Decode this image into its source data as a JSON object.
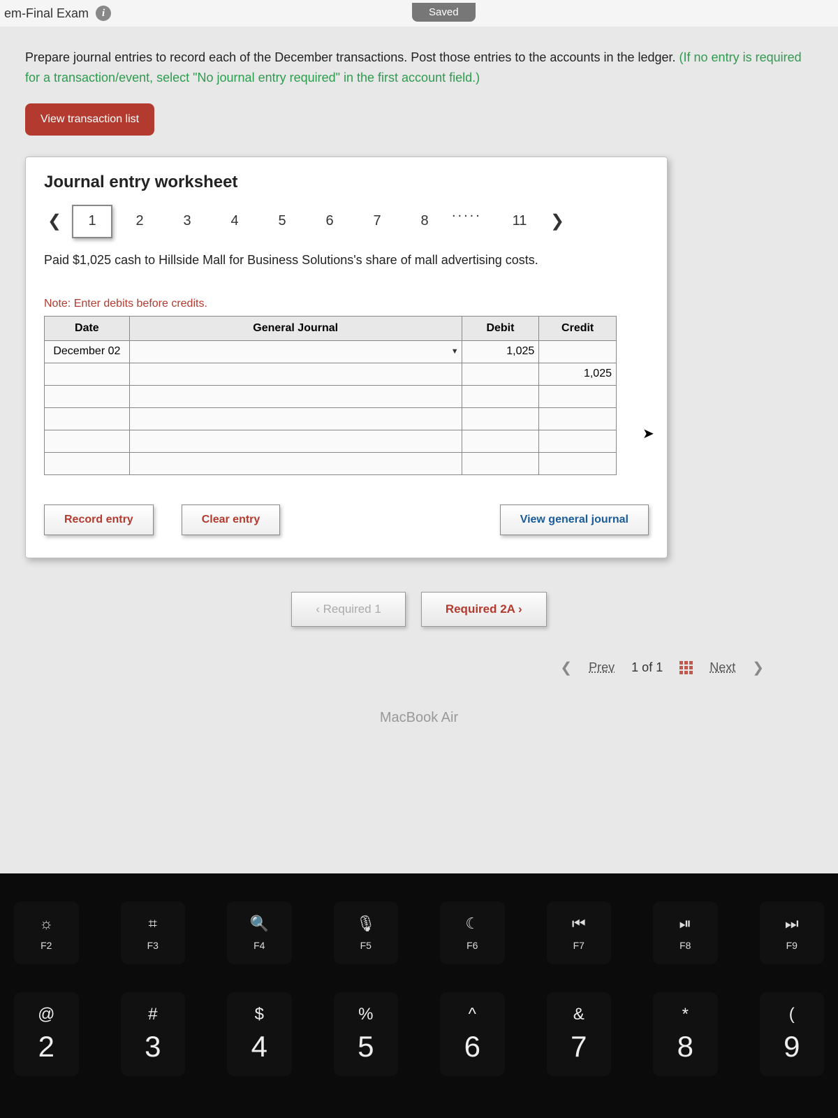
{
  "header": {
    "title": "em-Final Exam",
    "saved_label": "Saved"
  },
  "instructions": {
    "black": "Prepare journal entries to record each of the December transactions. Post those entries to the accounts in the ledger. ",
    "green": "(If no entry is required for a transaction/event, select \"No journal entry required\" in the first account field.)"
  },
  "buttons": {
    "view_tx": "View transaction list",
    "record": "Record entry",
    "clear": "Clear entry",
    "view_gj": "View general journal",
    "req1": "‹   Required 1",
    "req2": "Required 2A   ›"
  },
  "worksheet": {
    "title": "Journal entry worksheet",
    "tabs": [
      "1",
      "2",
      "3",
      "4",
      "5",
      "6",
      "7",
      "8",
      ".....",
      "11"
    ],
    "selected_tab": "1",
    "transaction_text": "Paid $1,025 cash to Hillside Mall for Business Solutions's share of mall advertising costs.",
    "note": "Note: Enter debits before credits.",
    "columns": {
      "date": "Date",
      "gj": "General Journal",
      "debit": "Debit",
      "credit": "Credit"
    },
    "rows": [
      {
        "date": "December 02",
        "gj": "",
        "debit": "1,025",
        "credit": ""
      },
      {
        "date": "",
        "gj": "",
        "debit": "",
        "credit": "1,025"
      },
      {
        "date": "",
        "gj": "",
        "debit": "",
        "credit": ""
      },
      {
        "date": "",
        "gj": "",
        "debit": "",
        "credit": ""
      },
      {
        "date": "",
        "gj": "",
        "debit": "",
        "credit": ""
      },
      {
        "date": "",
        "gj": "",
        "debit": "",
        "credit": ""
      }
    ]
  },
  "pager": {
    "prev": "Prev",
    "pos": "1 of 1",
    "next": "Next"
  },
  "laptop_label": "MacBook Air",
  "keyboard": {
    "frow": [
      {
        "icon": "☼",
        "label": "F2"
      },
      {
        "icon": "⌗",
        "label": "F3"
      },
      {
        "icon": "🔍",
        "label": "F4"
      },
      {
        "icon": "🎙",
        "label": "F5"
      },
      {
        "icon": "☾",
        "label": "F6"
      },
      {
        "icon": "⏮",
        "label": "F7"
      },
      {
        "icon": "⏯",
        "label": "F8"
      },
      {
        "icon": "⏭",
        "label": "F9"
      }
    ],
    "numrow": [
      {
        "sym": "@",
        "num": "2"
      },
      {
        "sym": "#",
        "num": "3"
      },
      {
        "sym": "$",
        "num": "4"
      },
      {
        "sym": "%",
        "num": "5"
      },
      {
        "sym": "^",
        "num": "6"
      },
      {
        "sym": "&",
        "num": "7"
      },
      {
        "sym": "*",
        "num": "8"
      },
      {
        "sym": "(",
        "num": "9"
      }
    ]
  }
}
